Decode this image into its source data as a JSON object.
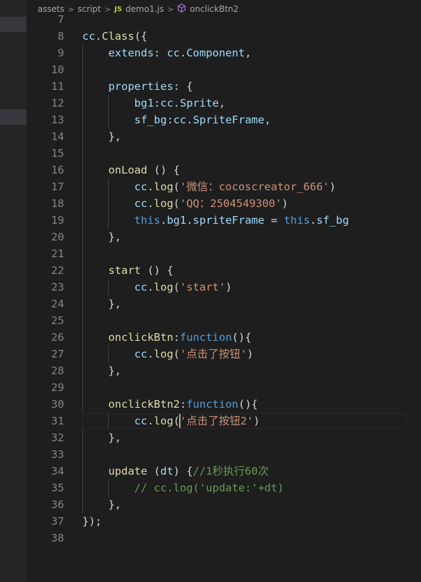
{
  "breadcrumb": {
    "items": [
      "assets",
      "script"
    ],
    "file_badge": "JS",
    "file_name": "demo1.js",
    "symbol_name": "onclickBtn2"
  },
  "colors": {
    "background": "#1e1e1e",
    "line_number": "#858585",
    "property": "#9cdcfe",
    "function": "#dcdcaa",
    "string": "#ce9178",
    "keyword": "#569cd6",
    "comment": "#6a9955"
  },
  "editor": {
    "cursor_line": "31",
    "lines": [
      {
        "num": "7",
        "tokens": []
      },
      {
        "num": "8",
        "tokens": [
          [
            "t-var",
            "cc"
          ],
          [
            "t-punc",
            "."
          ],
          [
            "t-fn",
            "Class"
          ],
          [
            "t-punc",
            "({"
          ]
        ]
      },
      {
        "num": "9",
        "tokens": [
          [
            "t-punc",
            "    "
          ],
          [
            "t-var",
            "extends"
          ],
          [
            "t-punc",
            ": "
          ],
          [
            "t-var",
            "cc"
          ],
          [
            "t-punc",
            "."
          ],
          [
            "t-var",
            "Component"
          ],
          [
            "t-punc",
            ","
          ]
        ]
      },
      {
        "num": "10",
        "tokens": []
      },
      {
        "num": "11",
        "tokens": [
          [
            "t-punc",
            "    "
          ],
          [
            "t-var",
            "properties"
          ],
          [
            "t-punc",
            ": {"
          ]
        ]
      },
      {
        "num": "12",
        "tokens": [
          [
            "t-punc",
            "        "
          ],
          [
            "t-var",
            "bg1"
          ],
          [
            "t-punc",
            ":"
          ],
          [
            "t-var",
            "cc"
          ],
          [
            "t-punc",
            "."
          ],
          [
            "t-var",
            "Sprite"
          ],
          [
            "t-punc",
            ","
          ]
        ]
      },
      {
        "num": "13",
        "tokens": [
          [
            "t-punc",
            "        "
          ],
          [
            "t-var",
            "sf_bg"
          ],
          [
            "t-punc",
            ":"
          ],
          [
            "t-var",
            "cc"
          ],
          [
            "t-punc",
            "."
          ],
          [
            "t-var",
            "SpriteFrame"
          ],
          [
            "t-punc",
            ","
          ]
        ]
      },
      {
        "num": "14",
        "tokens": [
          [
            "t-punc",
            "    },"
          ]
        ]
      },
      {
        "num": "15",
        "tokens": []
      },
      {
        "num": "16",
        "tokens": [
          [
            "t-punc",
            "    "
          ],
          [
            "t-fn",
            "onLoad"
          ],
          [
            "t-punc",
            " () {"
          ]
        ]
      },
      {
        "num": "17",
        "tokens": [
          [
            "t-punc",
            "        "
          ],
          [
            "t-var",
            "cc"
          ],
          [
            "t-punc",
            "."
          ],
          [
            "t-fn",
            "log"
          ],
          [
            "t-punc",
            "("
          ],
          [
            "t-str",
            "'微信：cocoscreator_666'"
          ],
          [
            "t-punc",
            ")"
          ]
        ]
      },
      {
        "num": "18",
        "tokens": [
          [
            "t-punc",
            "        "
          ],
          [
            "t-var",
            "cc"
          ],
          [
            "t-punc",
            "."
          ],
          [
            "t-fn",
            "log"
          ],
          [
            "t-punc",
            "("
          ],
          [
            "t-str",
            "'QQ：2504549300'"
          ],
          [
            "t-punc",
            ")"
          ]
        ]
      },
      {
        "num": "19",
        "tokens": [
          [
            "t-punc",
            "        "
          ],
          [
            "t-kw",
            "this"
          ],
          [
            "t-punc",
            "."
          ],
          [
            "t-var",
            "bg1"
          ],
          [
            "t-punc",
            "."
          ],
          [
            "t-var",
            "spriteFrame"
          ],
          [
            "t-punc",
            " = "
          ],
          [
            "t-kw",
            "this"
          ],
          [
            "t-punc",
            "."
          ],
          [
            "t-var",
            "sf_bg"
          ]
        ]
      },
      {
        "num": "20",
        "tokens": [
          [
            "t-punc",
            "    },"
          ]
        ]
      },
      {
        "num": "21",
        "tokens": []
      },
      {
        "num": "22",
        "tokens": [
          [
            "t-punc",
            "    "
          ],
          [
            "t-fn",
            "start"
          ],
          [
            "t-punc",
            " () {"
          ]
        ]
      },
      {
        "num": "23",
        "tokens": [
          [
            "t-punc",
            "        "
          ],
          [
            "t-var",
            "cc"
          ],
          [
            "t-punc",
            "."
          ],
          [
            "t-fn",
            "log"
          ],
          [
            "t-punc",
            "("
          ],
          [
            "t-str",
            "'start'"
          ],
          [
            "t-punc",
            ")"
          ]
        ]
      },
      {
        "num": "24",
        "tokens": [
          [
            "t-punc",
            "    },"
          ]
        ]
      },
      {
        "num": "25",
        "tokens": []
      },
      {
        "num": "26",
        "tokens": [
          [
            "t-punc",
            "    "
          ],
          [
            "t-fn",
            "onclickBtn"
          ],
          [
            "t-punc",
            ":"
          ],
          [
            "t-kw",
            "function"
          ],
          [
            "t-punc",
            "(){"
          ]
        ]
      },
      {
        "num": "27",
        "tokens": [
          [
            "t-punc",
            "        "
          ],
          [
            "t-var",
            "cc"
          ],
          [
            "t-punc",
            "."
          ],
          [
            "t-fn",
            "log"
          ],
          [
            "t-punc",
            "("
          ],
          [
            "t-str",
            "'点击了按钮'"
          ],
          [
            "t-punc",
            ")"
          ]
        ]
      },
      {
        "num": "28",
        "tokens": [
          [
            "t-punc",
            "    },"
          ]
        ]
      },
      {
        "num": "29",
        "tokens": []
      },
      {
        "num": "30",
        "tokens": [
          [
            "t-punc",
            "    "
          ],
          [
            "t-fn",
            "onclickBtn2"
          ],
          [
            "t-punc",
            ":"
          ],
          [
            "t-kw",
            "function"
          ],
          [
            "t-punc",
            "(){"
          ]
        ]
      },
      {
        "num": "31",
        "tokens": [
          [
            "t-punc",
            "        "
          ],
          [
            "t-var",
            "cc"
          ],
          [
            "t-punc",
            "."
          ],
          [
            "t-fn",
            "log"
          ],
          [
            "t-punc",
            "("
          ],
          [
            "t-str",
            "'点击了按钮2'"
          ],
          [
            "t-punc",
            ")"
          ]
        ]
      },
      {
        "num": "32",
        "tokens": [
          [
            "t-punc",
            "    },"
          ]
        ]
      },
      {
        "num": "33",
        "tokens": []
      },
      {
        "num": "34",
        "tokens": [
          [
            "t-punc",
            "    "
          ],
          [
            "t-fn",
            "update"
          ],
          [
            "t-punc",
            " ("
          ],
          [
            "t-var",
            "dt"
          ],
          [
            "t-punc",
            ") {"
          ],
          [
            "t-com",
            "//1秒执行60次"
          ]
        ]
      },
      {
        "num": "35",
        "tokens": [
          [
            "t-punc",
            "        "
          ],
          [
            "t-com",
            "// cc.log('update:'+dt)"
          ]
        ]
      },
      {
        "num": "36",
        "tokens": [
          [
            "t-punc",
            "    },"
          ]
        ]
      },
      {
        "num": "37",
        "tokens": [
          [
            "t-punc",
            "});"
          ]
        ]
      },
      {
        "num": "38",
        "tokens": []
      }
    ]
  }
}
